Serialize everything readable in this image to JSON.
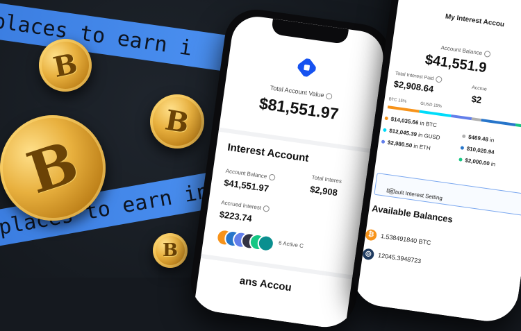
{
  "banner": {
    "top_text": "places to earn i",
    "bottom_text": "places to earn inter"
  },
  "phone_left": {
    "total_account_value_label": "Total Account Value",
    "total_account_value": "$81,551.97",
    "interest_account_title": "Interest Account",
    "account_balance_label": "Account Balance",
    "account_balance": "$41,551.97",
    "total_interest_label": "Total Interes",
    "total_interest_value": "$2,908",
    "accrued_interest_label": "Accrued Interest",
    "accrued_interest": "$223.74",
    "active_text": "6 Active C",
    "bottom_title": "ans Accou",
    "colors": {
      "logo": "#1652f0"
    }
  },
  "phone_right": {
    "title": "My Interest Accou",
    "account_balance_label": "Account Balance",
    "account_balance": "$41,551.9",
    "total_interest_paid_label": "Total Interest Paid",
    "total_interest_paid": "$2,908.64",
    "accrued_label": "Accrue",
    "accrued_value": "$2",
    "alloc_labels": [
      "BTC 15%",
      "GUSD 15%"
    ],
    "balances_left": [
      {
        "amount": "$14,035.66",
        "asset": "in BTC",
        "color": "#f7931a"
      },
      {
        "amount": "$12,045.39",
        "asset": "in GUSD",
        "color": "#00dcfa"
      },
      {
        "amount": "$2,980.50",
        "asset": "in ETH",
        "color": "#627eea"
      }
    ],
    "balances_right": [
      {
        "amount": "$469.48",
        "asset": "in",
        "color": "#b0b0b0"
      },
      {
        "amount": "$10,020.94",
        "asset": "",
        "color": "#2775ca"
      },
      {
        "amount": "$2,000.00",
        "asset": "in",
        "color": "#16c784"
      }
    ],
    "default_setting_label": "Default Interest Setting",
    "available_title": "Available Balances",
    "assets": [
      {
        "amount": "1.538491840 BTC",
        "icon": "bitcoin-icon",
        "color": "#f7931a",
        "glyph": "₿"
      },
      {
        "amount": "12045.3948723",
        "icon": "gusd-icon",
        "color": "#1e3a5f",
        "glyph": "◎"
      }
    ]
  }
}
